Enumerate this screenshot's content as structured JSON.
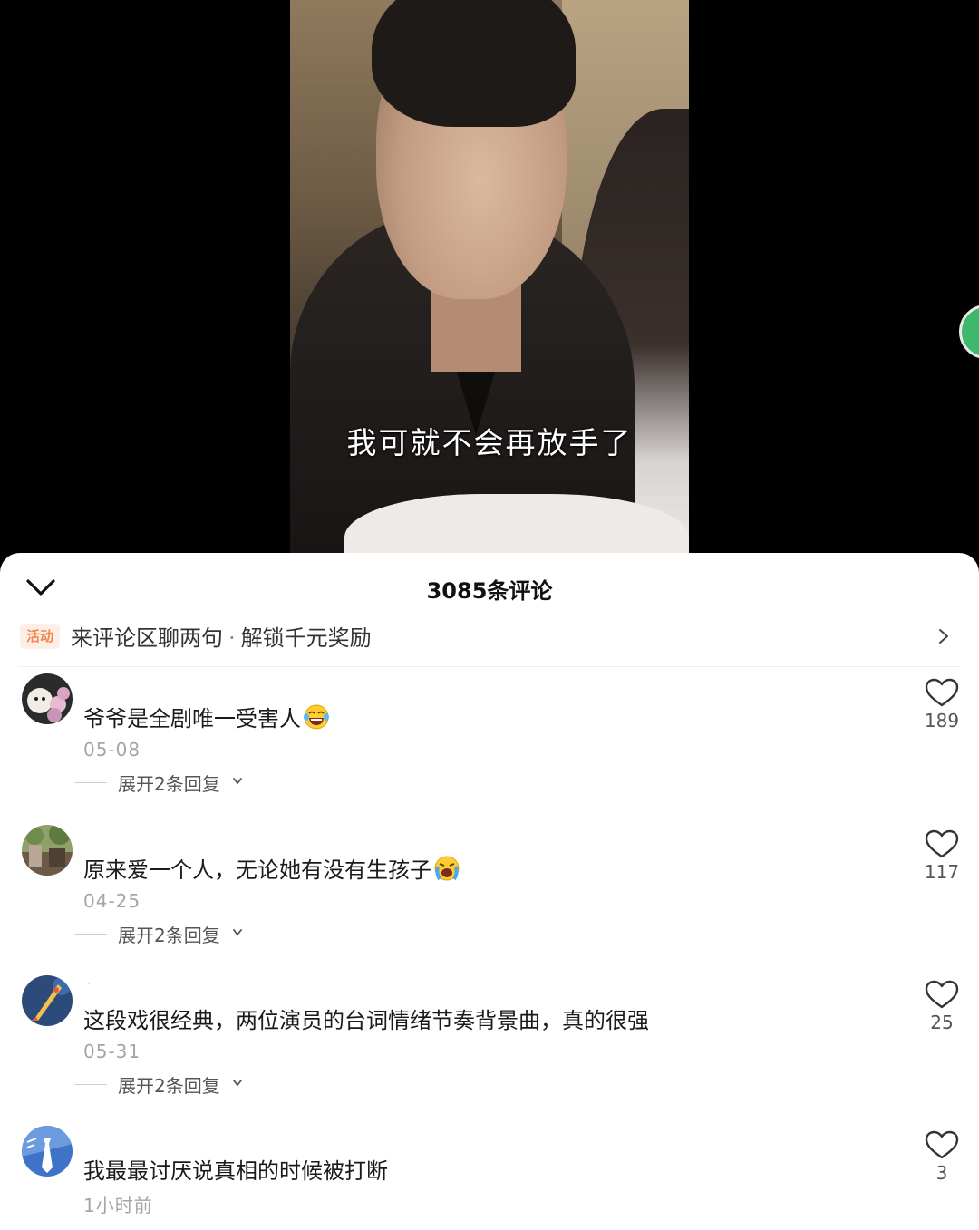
{
  "video": {
    "subtitle": "我可就不会再放手了"
  },
  "sheet": {
    "title": "3085条评论",
    "collapse_icon": "chevron-down-icon",
    "activity": {
      "badge": "活动",
      "text_main": "来评论区聊两句",
      "separator": "·",
      "text_reward": "解锁千元奖励",
      "chevron_icon": "chevron-right-icon"
    },
    "comments": [
      {
        "username": "",
        "text": "爷爷是全剧唯一受害人",
        "emoji": "laughing-tears-emoji",
        "date": "05-08",
        "expand_label": "展开2条回复",
        "likes": "189"
      },
      {
        "username": "",
        "text": "原来爱一个人，无论她有没有生孩子",
        "emoji": "crying-emoji",
        "date": "04-25",
        "expand_label": "展开2条回复",
        "likes": "117"
      },
      {
        "username": "·",
        "text": "这段戏很经典，两位演员的台词情绪节奏背景曲，真的很强",
        "date": "05-31",
        "expand_label": "展开2条回复",
        "likes": "25"
      },
      {
        "username": "",
        "text": "我最最讨厌说真相的时候被打断",
        "date": "1小时前",
        "likes": "3"
      }
    ]
  },
  "colors": {
    "activity_accent": "#f08a4b",
    "activity_badge_bg": "#fdeee6",
    "share_green": "#3eb86a"
  }
}
